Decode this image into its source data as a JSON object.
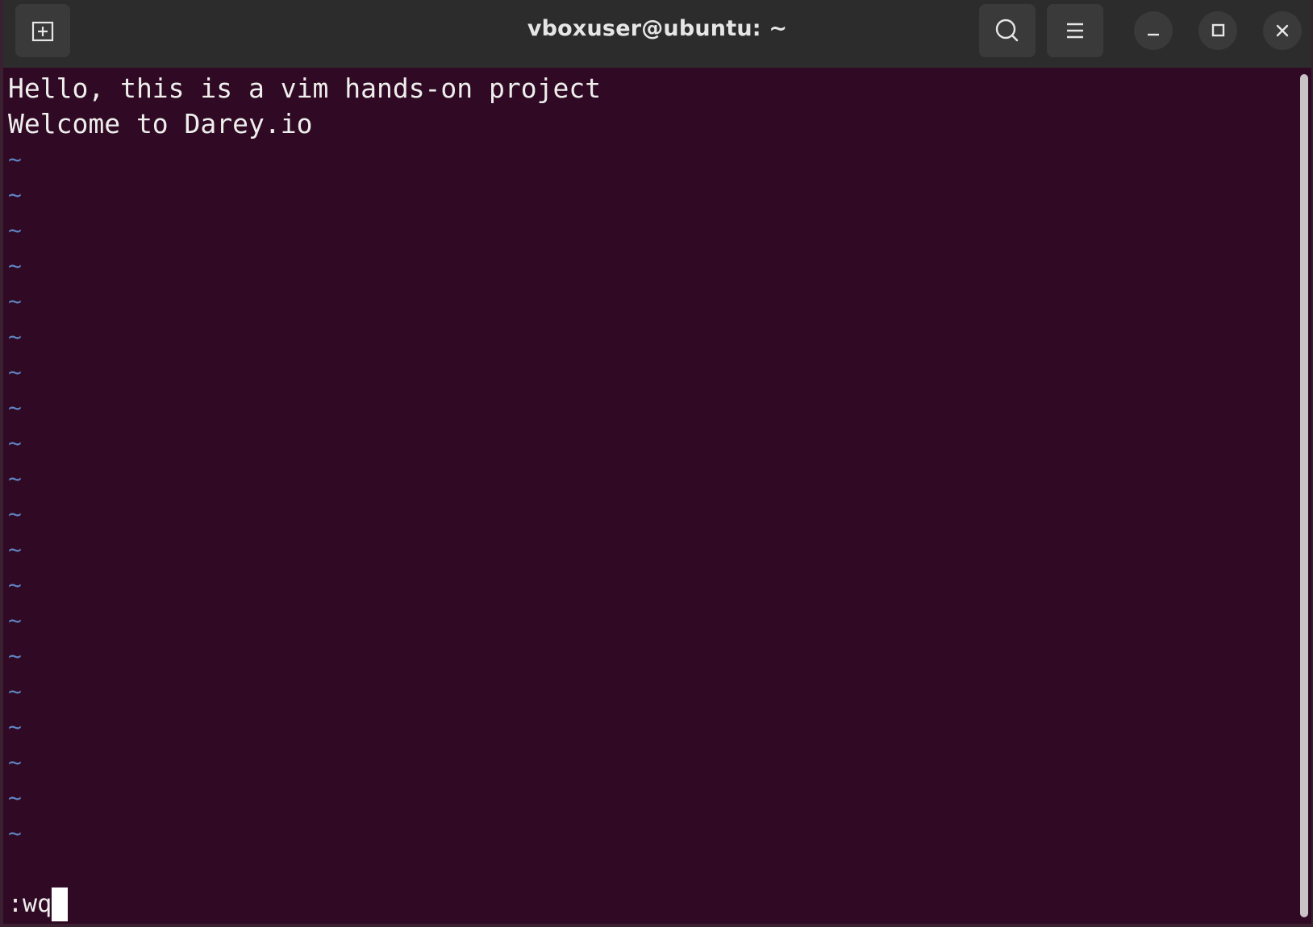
{
  "window": {
    "title": "vboxuser@ubuntu: ~"
  },
  "headerbar": {
    "new_tab_icon": "new-tab-icon",
    "search_icon": "search-icon",
    "menu_icon": "hamburger-menu-icon",
    "minimize_icon": "minimize-icon",
    "maximize_icon": "maximize-icon",
    "close_icon": "close-icon"
  },
  "editor": {
    "lines": [
      "Hello, this is a vim hands-on project",
      "Welcome to Darey.io"
    ],
    "empty_line_marker": "~",
    "empty_line_count": 20,
    "command": ":wq"
  },
  "colors": {
    "terminal_background": "#300a24",
    "text": "#eeeeec",
    "tilde": "#5f86c6",
    "titlebar": "#2c2c2c"
  }
}
